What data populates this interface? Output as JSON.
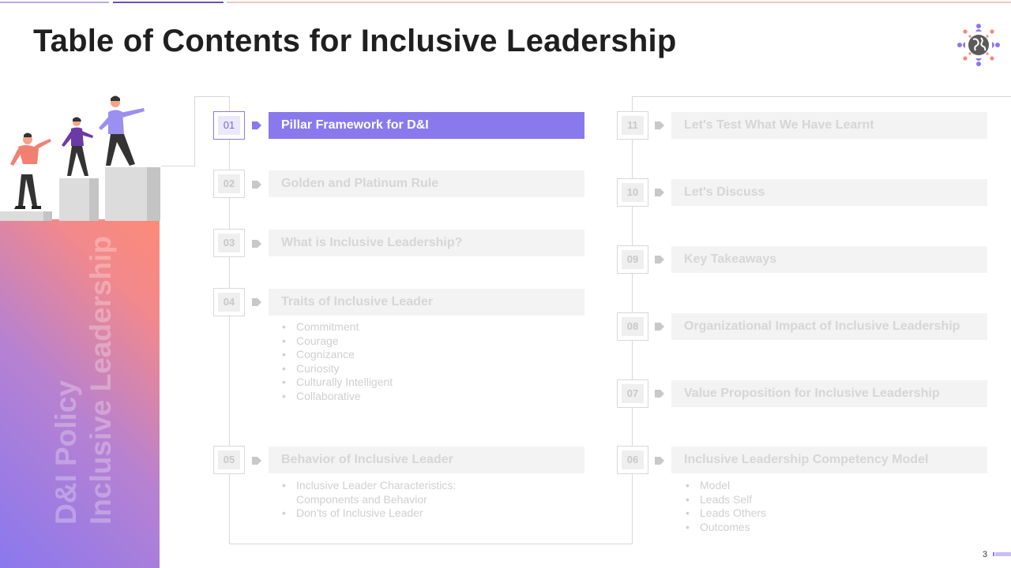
{
  "title": "Table of Contents for Inclusive Leadership",
  "side_panel": {
    "line1": "D&I Policy",
    "line2": "Inclusive Leadership"
  },
  "colors": {
    "accent": "#8a79ec",
    "gradient_start": "#8a78ee",
    "gradient_end": "#fb8a78"
  },
  "logo_icon": "globe-people-icon",
  "left_items": [
    {
      "num": "01",
      "label": "Pillar Framework for D&I",
      "active": true
    },
    {
      "num": "02",
      "label": "Golden and Platinum Rule"
    },
    {
      "num": "03",
      "label": "What is Inclusive Leadership?"
    },
    {
      "num": "04",
      "label": "Traits of Inclusive Leader",
      "subitems": [
        "Commitment",
        "Courage",
        "Cognizance",
        "Curiosity",
        "Culturally Intelligent",
        "Collaborative"
      ]
    },
    {
      "num": "05",
      "label": "Behavior of Inclusive Leader",
      "subitems": [
        "Inclusive Leader Characteristics:",
        "Components and Behavior",
        "Don'ts of Inclusive Leader"
      ]
    }
  ],
  "right_items": [
    {
      "num": "11",
      "label": "Let's Test What We Have Learnt"
    },
    {
      "num": "10",
      "label": "Let's Discuss"
    },
    {
      "num": "09",
      "label": "Key Takeaways"
    },
    {
      "num": "08",
      "label": "Organizational Impact of Inclusive Leadership"
    },
    {
      "num": "07",
      "label": "Value Proposition for Inclusive Leadership"
    },
    {
      "num": "06",
      "label": "Inclusive Leadership Competency Model",
      "subitems": [
        "Model",
        "Leads Self",
        "Leads Others",
        "Outcomes"
      ]
    }
  ],
  "page_number": "3"
}
